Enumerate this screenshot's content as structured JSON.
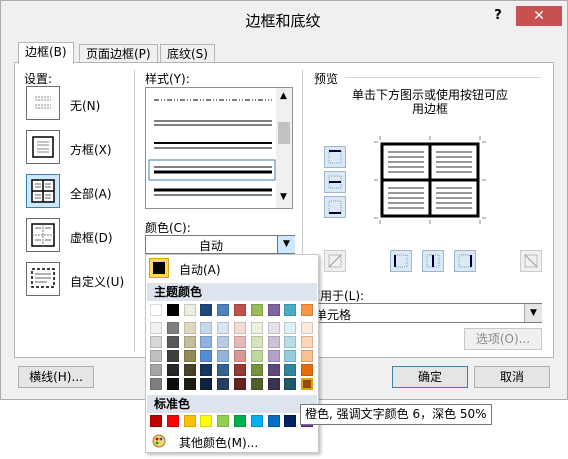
{
  "dialog": {
    "title": "边框和底纹",
    "help_label": "?",
    "close_label": "✕",
    "tabs": [
      {
        "label": "边框(B)",
        "active": true
      },
      {
        "label": "页面边框(P)",
        "active": false
      },
      {
        "label": "底纹(S)",
        "active": false
      }
    ]
  },
  "settings": {
    "heading": "设置:",
    "items": [
      {
        "label": "无(N)",
        "icon": "border-none-icon"
      },
      {
        "label": "方框(X)",
        "icon": "border-box-icon"
      },
      {
        "label": "全部(A)",
        "icon": "border-all-icon",
        "selected": true
      },
      {
        "label": "虚框(D)",
        "icon": "border-grid-icon"
      },
      {
        "label": "自定义(U)",
        "icon": "border-custom-icon"
      }
    ]
  },
  "style": {
    "heading": "样式(Y):"
  },
  "color": {
    "heading": "颜色(C):",
    "value": "自动",
    "popup": {
      "auto_label": "自动(A)",
      "theme_heading": "主题颜色",
      "standard_heading": "标准色",
      "more_label": "其他颜色(M)...",
      "theme_top": [
        "#ffffff",
        "#000000",
        "#eeece1",
        "#1f497d",
        "#4f81bd",
        "#c0504d",
        "#9bbb59",
        "#8064a2",
        "#4bacc6",
        "#f79646"
      ],
      "theme_shades": [
        [
          "#f2f2f2",
          "#7f7f7f",
          "#ddd9c3",
          "#c6d9f0",
          "#dbe5f1",
          "#f2dcdb",
          "#ebf1dd",
          "#e5e0ec",
          "#dbeef3",
          "#fdeada"
        ],
        [
          "#d8d8d8",
          "#595959",
          "#c4bd97",
          "#8db3e2",
          "#b8cce4",
          "#e5b9b7",
          "#d7e3bc",
          "#ccc1d9",
          "#b7dde8",
          "#fbd5b5"
        ],
        [
          "#bfbfbf",
          "#3f3f3f",
          "#938953",
          "#548dd4",
          "#95b3d7",
          "#d99694",
          "#c3d69b",
          "#b2a2c7",
          "#92cddc",
          "#fac08f"
        ],
        [
          "#a5a5a5",
          "#262626",
          "#494429",
          "#17365d",
          "#366092",
          "#953734",
          "#76923c",
          "#5f497a",
          "#31859b",
          "#e36c09"
        ],
        [
          "#7f7f7f",
          "#0c0c0c",
          "#1d1b10",
          "#0f243e",
          "#244061",
          "#632423",
          "#4f6128",
          "#3f3151",
          "#205867",
          "#974806"
        ]
      ],
      "standard": [
        "#c00000",
        "#ff0000",
        "#ffc000",
        "#ffff00",
        "#92d050",
        "#00b050",
        "#00b0f0",
        "#0070c0",
        "#002060",
        "#7030a0"
      ]
    },
    "tooltip": "橙色, 强调文字颜色 6，深色 50%"
  },
  "preview": {
    "heading": "预览",
    "hint": "单击下方图示或使用按钮可应用边框"
  },
  "apply_to": {
    "heading": "应用于(L):",
    "value": "单元格"
  },
  "buttons": {
    "options": "选项(O)...",
    "horizontal_line": "横线(H)...",
    "ok": "确定",
    "cancel": "取消"
  }
}
